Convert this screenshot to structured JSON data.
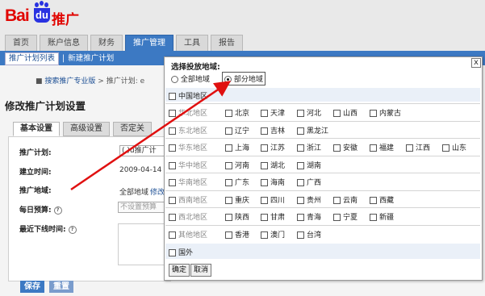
{
  "logo": {
    "word": "Bai",
    "du": "du",
    "tag": "推广"
  },
  "nav": {
    "tabs": [
      "首页",
      "账户信息",
      "财务",
      "推广管理",
      "工具",
      "报告"
    ],
    "active": 3
  },
  "subnav": {
    "item1": "推广计划列表",
    "sep": "|",
    "item2": "新建推广计划"
  },
  "breadcrumb": {
    "link": "搜索推广专业版",
    "sep": ">",
    "current": "推广计划: e"
  },
  "page_title": "修改推广计划设置",
  "content_tabs": [
    "基本设置",
    "高级设置",
    "否定关"
  ],
  "form": {
    "name_label": "推广计划:",
    "name_value": "(    )u推广计",
    "created_label": "建立时间:",
    "created_value": "2009-04-14",
    "region_label": "推广地域:",
    "region_value": "全部地域",
    "region_edit": "修改",
    "budget_label": "每日预算:",
    "budget_placeholder": "不设置预算",
    "offline_label": "最近下线时间:"
  },
  "buttons": {
    "save": "保存",
    "reset": "重置"
  },
  "dialog": {
    "title": "选择投放地域:",
    "close": "x",
    "option_all": "全部地域",
    "option_part": "部分地域",
    "china": "中国地区",
    "regions": [
      {
        "name": "华北地区",
        "provinces": [
          "北京",
          "天津",
          "河北",
          "山西",
          "内蒙古"
        ]
      },
      {
        "name": "东北地区",
        "provinces": [
          "辽宁",
          "吉林",
          "黑龙江"
        ]
      },
      {
        "name": "华东地区",
        "provinces": [
          "上海",
          "江苏",
          "浙江",
          "安徽",
          "福建",
          "江西",
          "山东"
        ]
      },
      {
        "name": "华中地区",
        "provinces": [
          "河南",
          "湖北",
          "湖南"
        ]
      },
      {
        "name": "华南地区",
        "provinces": [
          "广东",
          "海南",
          "广西"
        ]
      },
      {
        "name": "西南地区",
        "provinces": [
          "重庆",
          "四川",
          "贵州",
          "云南",
          "西藏"
        ]
      },
      {
        "name": "西北地区",
        "provinces": [
          "陕西",
          "甘肃",
          "青海",
          "宁夏",
          "新疆"
        ]
      },
      {
        "name": "其他地区",
        "provinces": [
          "香港",
          "澳门",
          "台湾"
        ]
      }
    ],
    "abroad": "国外",
    "ok": "确定",
    "cancel": "取消"
  },
  "colors": {
    "nav_blue": "#3c79c3",
    "arrow_red": "#e01010",
    "button_blue": "#3c79c3"
  }
}
